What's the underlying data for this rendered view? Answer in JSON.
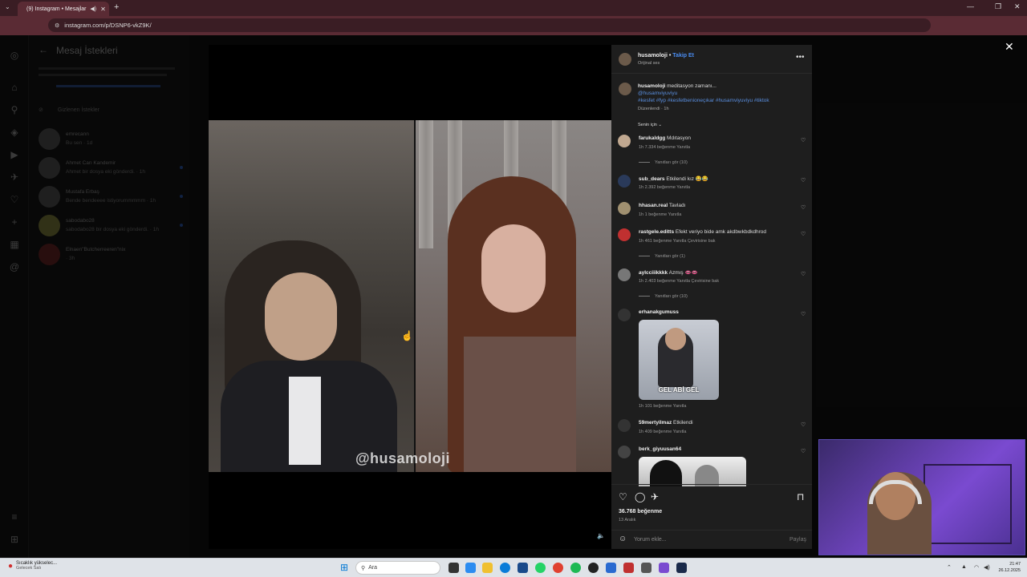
{
  "browser": {
    "tab_title": "(9) Instagram • Mesajlar",
    "url": "instagram.com/p/DSNP6-vkZ9K/"
  },
  "dm_panel": {
    "title": "Mesaj İstekleri",
    "hidden_requests": "Gizlenen İstekler",
    "conversations": [
      {
        "name": "emrecann",
        "message": "Bu sen · 1d"
      },
      {
        "name": "Ahmet Can Kandemir",
        "message": "Ahmet bir dosya eki gönderdi. · 1h"
      },
      {
        "name": "Mustafa Erbaş",
        "message": "Bende bendeeee istiyorummmmm · 1h"
      },
      {
        "name": "sabodabo28",
        "message": "sabodabo28 bir dosya eki gönderdi. · 1h"
      },
      {
        "name": "Elnaen\"Butcherreeren\"nix",
        "message": "· 3h"
      }
    ]
  },
  "video": {
    "watermark": "@husamoloji"
  },
  "post": {
    "username": "husamoloji",
    "follow": "Takip Et",
    "audio": "Orijinal ses",
    "caption_user": "husamoloji",
    "caption_text": "meditasyon zamanı...",
    "caption_mention": "@husamviyuviyu",
    "caption_tags": "#kesfet #fyp #kesfetbenioneçıkar #husamviyuviyu #tiktok",
    "caption_meta": "Düzenlendi · 1h",
    "sort": "Senin için",
    "likes": "36.768 beğenme",
    "date": "13 Aralık",
    "comment_placeholder": "Yorum ekle...",
    "share": "Paylaş"
  },
  "comments": [
    {
      "user": "farukaldgg",
      "text": "Mdıtasyon",
      "meta": "1h   7.334 beğenme   Yanıtla",
      "replies": "Yanıtları gör (10)"
    },
    {
      "user": "sub_dears",
      "text": "Etkilendi kız 😂😂",
      "meta": "1h   2.392 beğenme   Yanıtla",
      "replies": ""
    },
    {
      "user": "hhasan.real",
      "text": "Tavladı",
      "meta": "1h   1 beğenme   Yanıtla",
      "replies": ""
    },
    {
      "user": "rastgele.editts",
      "text": "Efekt veriyo bide amk akdbwkbdkdhrod",
      "meta": "1h   461 beğenme   Yanıtla   Çevirisine bak",
      "replies": "Yanıtları gör (1)"
    },
    {
      "user": "aylcciiikkkk",
      "text": "Azmış 👄👄",
      "meta": "1h   2.403 beğenme   Yanıtla   Çevirisine bak",
      "replies": "Yanıtları gör (10)"
    },
    {
      "user": "erhanakgumuss",
      "text": "",
      "meta": "1h   101 beğenme   Yanıtla",
      "replies": "",
      "gif_text": "GEL ABİ GEL"
    },
    {
      "user": "59mertyilmaz",
      "text": "Etkilendi",
      "meta": "1h   409 beğenme   Yanıtla",
      "replies": ""
    },
    {
      "user": "berk_giyuusan64",
      "text": "",
      "meta": "",
      "replies": ""
    }
  ],
  "taskbar": {
    "weather_title": "Sıcaklık yükselec...",
    "weather_sub": "Gelecek Salı",
    "search_placeholder": "Ara",
    "time": "21:47",
    "date": "26.12.2025"
  },
  "colors": {
    "panel_bg": "#1e1e1e",
    "link_blue": "#4a8cf0",
    "chrome_bg": "#5a2b34"
  }
}
